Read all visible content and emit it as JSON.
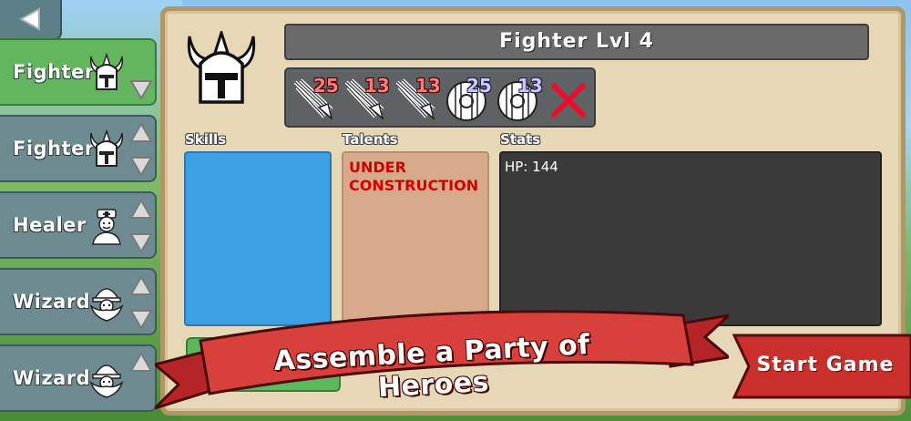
{
  "back_button": {
    "icon": "triangle-left-icon"
  },
  "heroes": [
    {
      "name": "Fighter",
      "icon": "viking-helmet-icon",
      "selected": true,
      "arrows": [
        "down"
      ]
    },
    {
      "name": "Fighter",
      "icon": "viking-helmet-icon",
      "selected": false,
      "arrows": [
        "up",
        "down"
      ]
    },
    {
      "name": "Healer",
      "icon": "nurse-icon",
      "selected": false,
      "arrows": [
        "up",
        "down"
      ]
    },
    {
      "name": "Wizard",
      "icon": "wizard-face-icon",
      "selected": false,
      "arrows": [
        "up",
        "down"
      ]
    },
    {
      "name": "Wizard",
      "icon": "wizard-face-icon",
      "selected": false,
      "arrows": [
        "up"
      ]
    }
  ],
  "detail": {
    "title": "Fighter Lvl 4",
    "portrait_icon": "viking-helmet-icon",
    "abilities": [
      {
        "type": "attack",
        "icon": "sword-strike-icon",
        "value": "25"
      },
      {
        "type": "attack",
        "icon": "sword-strike-icon",
        "value": "13"
      },
      {
        "type": "attack",
        "icon": "sword-strike-icon",
        "value": "13"
      },
      {
        "type": "defense",
        "icon": "round-shield-icon",
        "value": "25"
      },
      {
        "type": "defense",
        "icon": "round-shield-icon",
        "value": "13"
      },
      {
        "type": "empty",
        "icon": "red-x-icon",
        "value": ""
      }
    ],
    "skills_label": "Skills",
    "talents_label": "Talents",
    "stats_label": "Stats",
    "talents_text": "UNDER CONSTRUCTION",
    "stats_text": "HP: 144"
  },
  "banner_text": "Assemble a Party of Heroes",
  "start_button": "Start Game",
  "colors": {
    "selected": "#63b55e",
    "unselected": "#6d8b91",
    "skills": "#3c9ee3",
    "talents": "#d8aa8c",
    "start": "#c9302c"
  }
}
